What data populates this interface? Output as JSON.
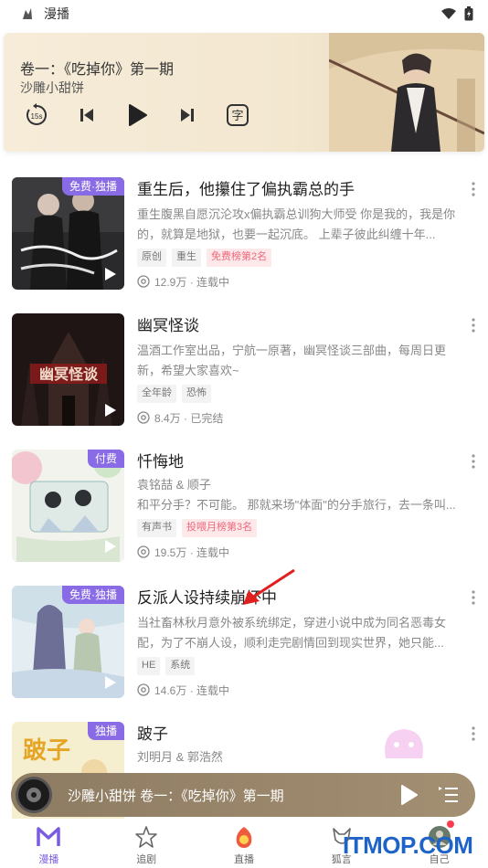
{
  "status_bar": {
    "app_name": "漫播"
  },
  "player": {
    "title": "卷一：《吃掉你》第一期",
    "author": "沙雕小甜饼",
    "skip_label": "15s",
    "subtitle_label": "字"
  },
  "items": [
    {
      "badge": "免费·独播",
      "name": "重生后，他攥住了偏执霸总的手",
      "desc": "重生腹黑自愿沉沦攻x偏执霸总训狗大师受 你是我的，我是你的，就算是地狱，也要一起沉底。 上辈子彼此纠缠十年...",
      "sub": "",
      "tags": [
        "原创",
        "重生"
      ],
      "hot_tag": "免费榜第2名",
      "plays": "12.9万 · 连载中"
    },
    {
      "badge": "",
      "name": "幽冥怪谈",
      "desc": "温酒工作室出品，宁航一原著，幽冥怪谈三部曲，每周日更新，希望大家喜欢~",
      "sub": "",
      "tags": [
        "全年龄",
        "恐怖"
      ],
      "hot_tag": "",
      "plays": "8.4万 · 已完结"
    },
    {
      "badge": "付费",
      "name": "忏悔地",
      "desc": "和平分手？不可能。 那就来场\"体面\"的分手旅行，去一条叫...",
      "sub": "袁铭喆 & 顺子",
      "tags": [
        "有声书"
      ],
      "hot_tag": "投喂月榜第3名",
      "plays": "19.5万 · 连载中"
    },
    {
      "badge": "免费·独播",
      "name": "反派人设持续崩坏中",
      "desc": "当社畜林秋月意外被系统绑定，穿进小说中成为同名恶毒女配，为了不崩人设，顺利走完剧情回到现实世界，她只能...",
      "sub": "",
      "tags": [
        "HE",
        "系统"
      ],
      "hot_tag": "",
      "plays": "14.6万 · 连载中"
    },
    {
      "badge": "独播",
      "name": "跛子",
      "desc": "",
      "sub": "刘明月 & 郭浩然",
      "tags": [],
      "hot_tag": "",
      "plays": ""
    }
  ],
  "mini_player": {
    "title": "沙雕小甜饼 卷一：《吃掉你》第一期"
  },
  "tabs": [
    {
      "label": "漫播",
      "icon": "manbo-logo-icon",
      "active": true
    },
    {
      "label": "追剧",
      "icon": "star-icon",
      "active": false
    },
    {
      "label": "直播",
      "icon": "live-icon",
      "active": false
    },
    {
      "label": "狐言",
      "icon": "fox-icon",
      "active": false
    },
    {
      "label": "自己",
      "icon": "avatar-icon",
      "active": false
    }
  ],
  "watermark": "ITMOP.COM",
  "colors": {
    "accent": "#7b5ce0",
    "badge": "#8a6be6",
    "hot_tag": "#ee6a7c",
    "watermark": "#1e64c8"
  }
}
